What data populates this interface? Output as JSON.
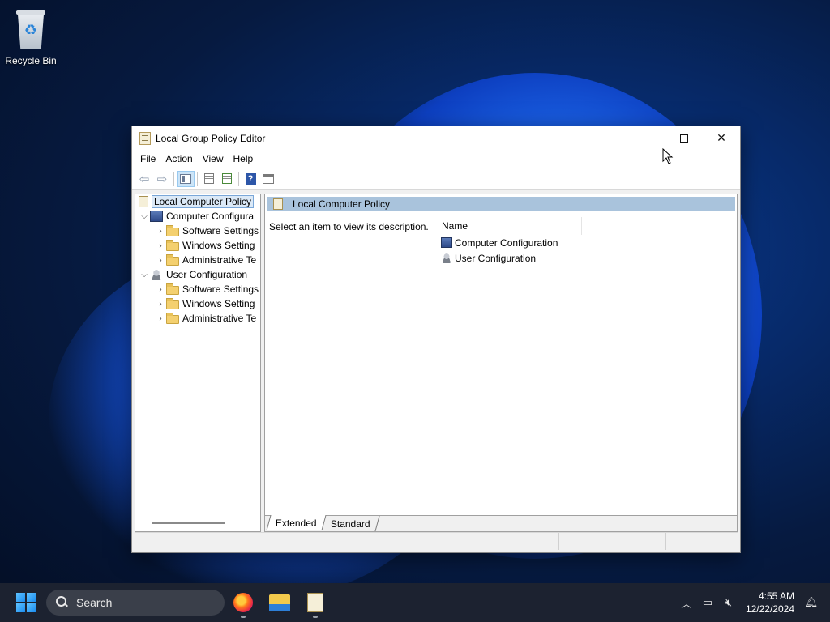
{
  "desktop": {
    "icons": [
      {
        "label": "Recycle Bin",
        "icon": "recycle-bin-icon"
      }
    ]
  },
  "window": {
    "title": "Local Group Policy Editor",
    "controls": {
      "minimize": "─",
      "maximize": "☐",
      "close": "✕"
    },
    "menu": [
      "File",
      "Action",
      "View",
      "Help"
    ],
    "tree": {
      "root": "Local Computer Policy",
      "computer_config": "Computer Configura",
      "computer_children": [
        "Software Settings",
        "Windows Setting",
        "Administrative Te"
      ],
      "user_config": "User Configuration",
      "user_children": [
        "Software Settings",
        "Windows Setting",
        "Administrative Te"
      ]
    },
    "detail": {
      "header": "Local Computer Policy",
      "description": "Select an item to view its description.",
      "column_name": "Name",
      "items": [
        "Computer Configuration",
        "User Configuration"
      ]
    },
    "tabs": [
      "Extended",
      "Standard"
    ]
  },
  "taskbar": {
    "search_placeholder": "Search",
    "apps": [
      "firefox-icon",
      "file-explorer-icon",
      "group-policy-editor-icon"
    ],
    "time": "4:55 AM",
    "date": "12/22/2024"
  }
}
